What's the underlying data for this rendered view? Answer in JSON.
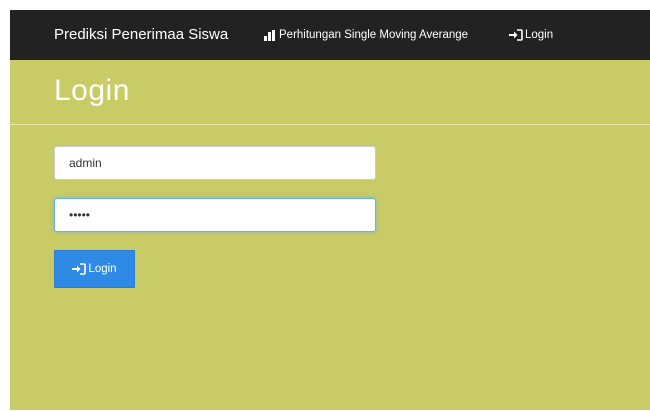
{
  "navbar": {
    "brand": "Prediksi Penerimaa Siswa",
    "links": [
      {
        "label": "Perhitungan Single Moving Averange",
        "icon": "bar-chart-icon"
      },
      {
        "label": "Login",
        "icon": "sign-in-icon"
      }
    ]
  },
  "page": {
    "title": "Login"
  },
  "form": {
    "username_value": "admin",
    "password_value": "•••••",
    "submit_label": "Login",
    "submit_icon": "sign-in-icon"
  },
  "colors": {
    "navbar_bg": "#222222",
    "page_bg": "#c9cb66",
    "button_bg": "#2f8ae6",
    "focus_border": "#66afe9"
  }
}
